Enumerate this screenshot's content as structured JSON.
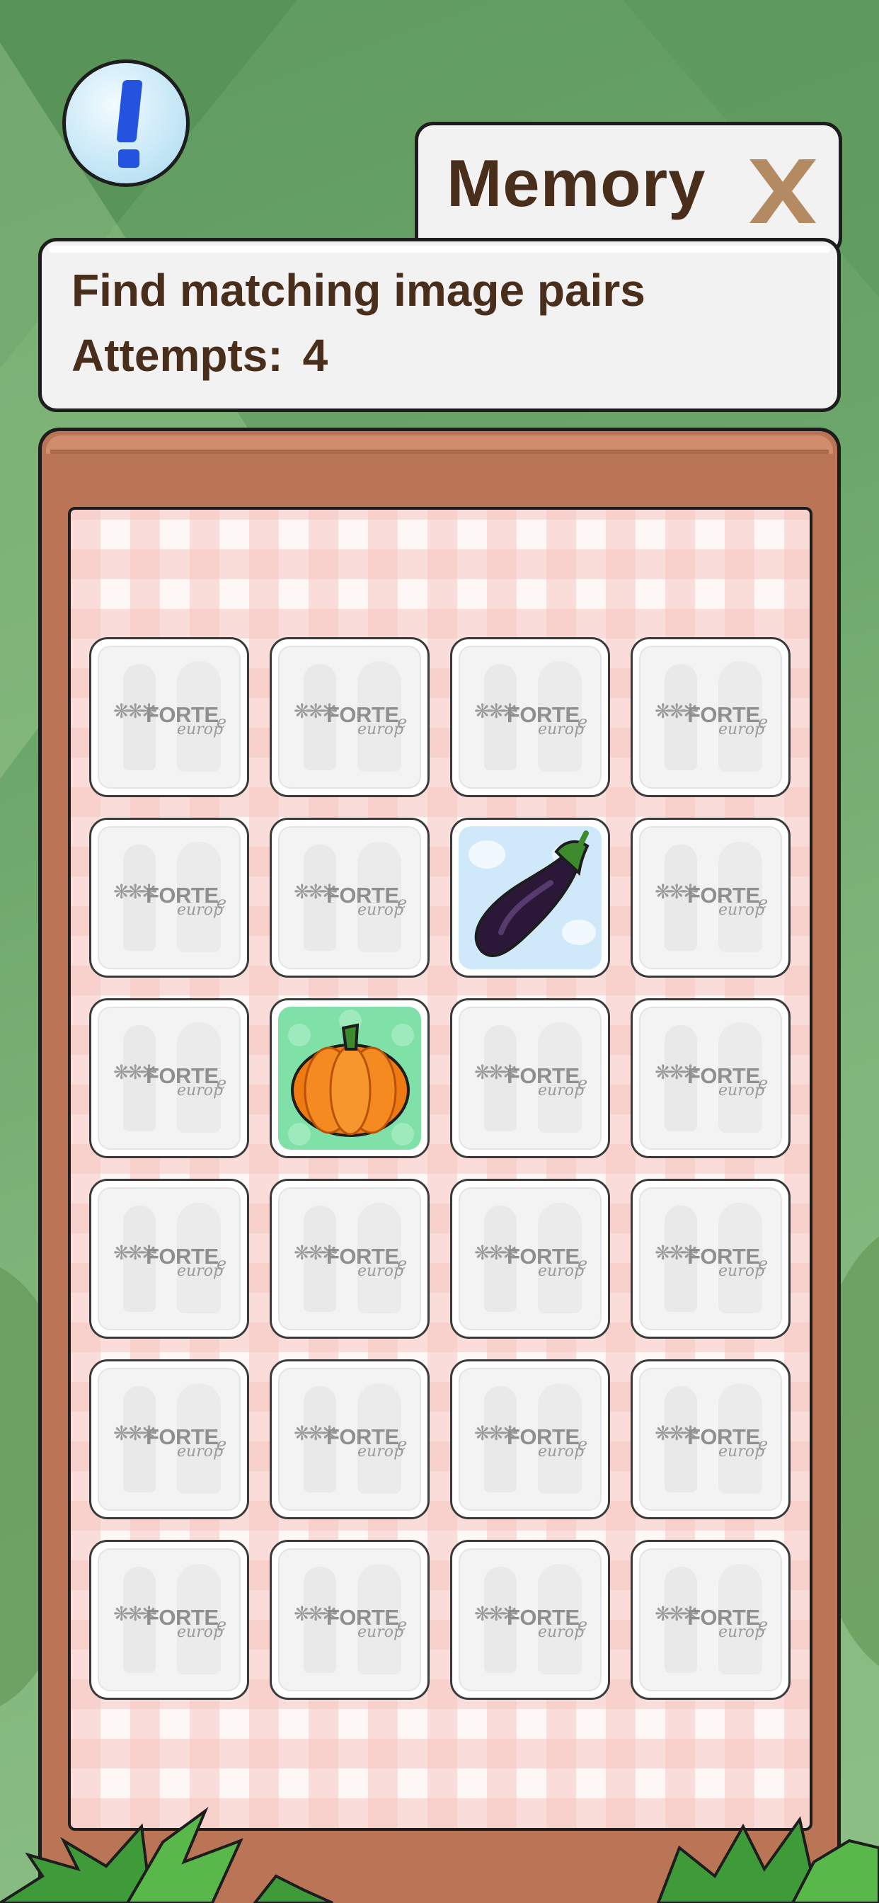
{
  "game": {
    "title": "Memory",
    "instruction": "Find matching image pairs",
    "attempts_label": "Attempts:",
    "attempts_value": "4"
  },
  "icons": {
    "info": "exclamation-icon",
    "close": "close-icon"
  },
  "colors": {
    "title_text": "#4a2e1c",
    "board_wood": "#b97556",
    "info_button": "#2453e0",
    "close_x": "#b48a62"
  },
  "card_back": {
    "logo_text": "FORTE",
    "logo_sub": "europ",
    "logo_e": "e"
  },
  "cards": [
    {
      "state": "hidden"
    },
    {
      "state": "hidden"
    },
    {
      "state": "hidden"
    },
    {
      "state": "hidden"
    },
    {
      "state": "hidden"
    },
    {
      "state": "hidden"
    },
    {
      "state": "revealed",
      "image": "eggplant"
    },
    {
      "state": "hidden"
    },
    {
      "state": "hidden"
    },
    {
      "state": "revealed",
      "image": "pumpkin"
    },
    {
      "state": "hidden"
    },
    {
      "state": "hidden"
    },
    {
      "state": "hidden"
    },
    {
      "state": "hidden"
    },
    {
      "state": "hidden"
    },
    {
      "state": "hidden"
    },
    {
      "state": "hidden"
    },
    {
      "state": "hidden"
    },
    {
      "state": "hidden"
    },
    {
      "state": "hidden"
    },
    {
      "state": "hidden"
    },
    {
      "state": "hidden"
    },
    {
      "state": "hidden"
    },
    {
      "state": "hidden"
    }
  ]
}
